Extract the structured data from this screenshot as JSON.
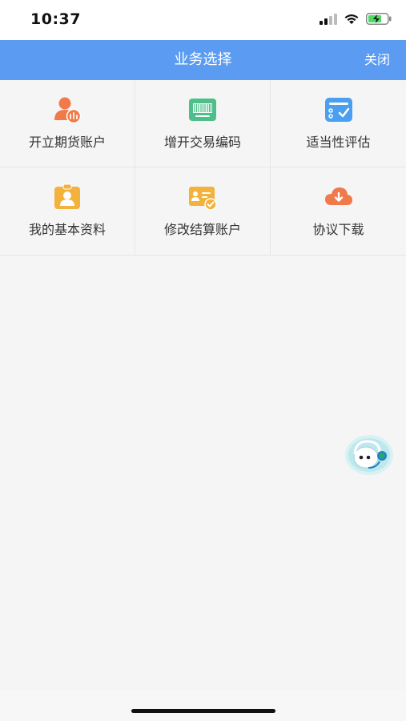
{
  "status_bar": {
    "time": "10:37"
  },
  "nav": {
    "title": "业务选择",
    "close_label": "关闭"
  },
  "services": [
    {
      "label": "开立期货账户",
      "icon": "open-account-icon",
      "color": "#f07a4a"
    },
    {
      "label": "增开交易编码",
      "icon": "barcode-icon",
      "color": "#4cbf8a"
    },
    {
      "label": "适当性评估",
      "icon": "assessment-checklist-icon",
      "color": "#4a9ff0"
    },
    {
      "label": "我的基本资料",
      "icon": "profile-card-icon",
      "color": "#f2b23c"
    },
    {
      "label": "修改结算账户",
      "icon": "settlement-card-icon",
      "color": "#f2b23c"
    },
    {
      "label": "协议下载",
      "icon": "cloud-download-icon",
      "color": "#f07a4a"
    }
  ],
  "floating": {
    "icon": "customer-service-robot-icon"
  }
}
